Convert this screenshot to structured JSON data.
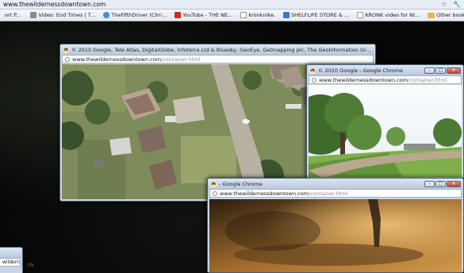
{
  "host": {
    "url": "www.thewildernessdowntown.com",
    "toolbar_icons": [
      "star-icon",
      "wrench-icon"
    ]
  },
  "bookmarks": {
    "items": [
      {
        "label": "ort P...",
        "icon_color": "#b0b0b0"
      },
      {
        "label": "Video: End Times | T...",
        "icon_color": "#8a8a8a"
      },
      {
        "label": "TheFifthDriver (Chri...",
        "icon_color": "#3d8fd8"
      },
      {
        "label": "YouTube - THE NE...",
        "icon_color": "#d42a1f"
      },
      {
        "label": "kronknike.",
        "icon_color": "#c8c8c8"
      },
      {
        "label": "SHELFLIFE STORE & ...",
        "icon_color": "#3a7ad0"
      },
      {
        "label": "KRONK video for NI...",
        "icon_color": "#c8c8c8"
      }
    ],
    "other": "Other bookmarks"
  },
  "windows": {
    "map": {
      "title": "© 2010 Google, Tele Atlas, DigitalGlobe, Infoterra Ltd & Bluesky, GeoEye, Getmapping plc, The GeoInformation Group - G...",
      "url_host": "www.thewildernessdowntown.com",
      "url_path": "/container.html"
    },
    "street": {
      "title": "© 2010 Google - Google Chrome",
      "url_host": "www.thewildernessdowntown.com",
      "url_path": "/container.html"
    },
    "video": {
      "title": "- Google Chrome",
      "url_host": "www.thewildernessdowntown.com",
      "url_path": "/container.html"
    },
    "small": {
      "url_host": "wildernessd"
    }
  },
  "desktop_text": "thi"
}
